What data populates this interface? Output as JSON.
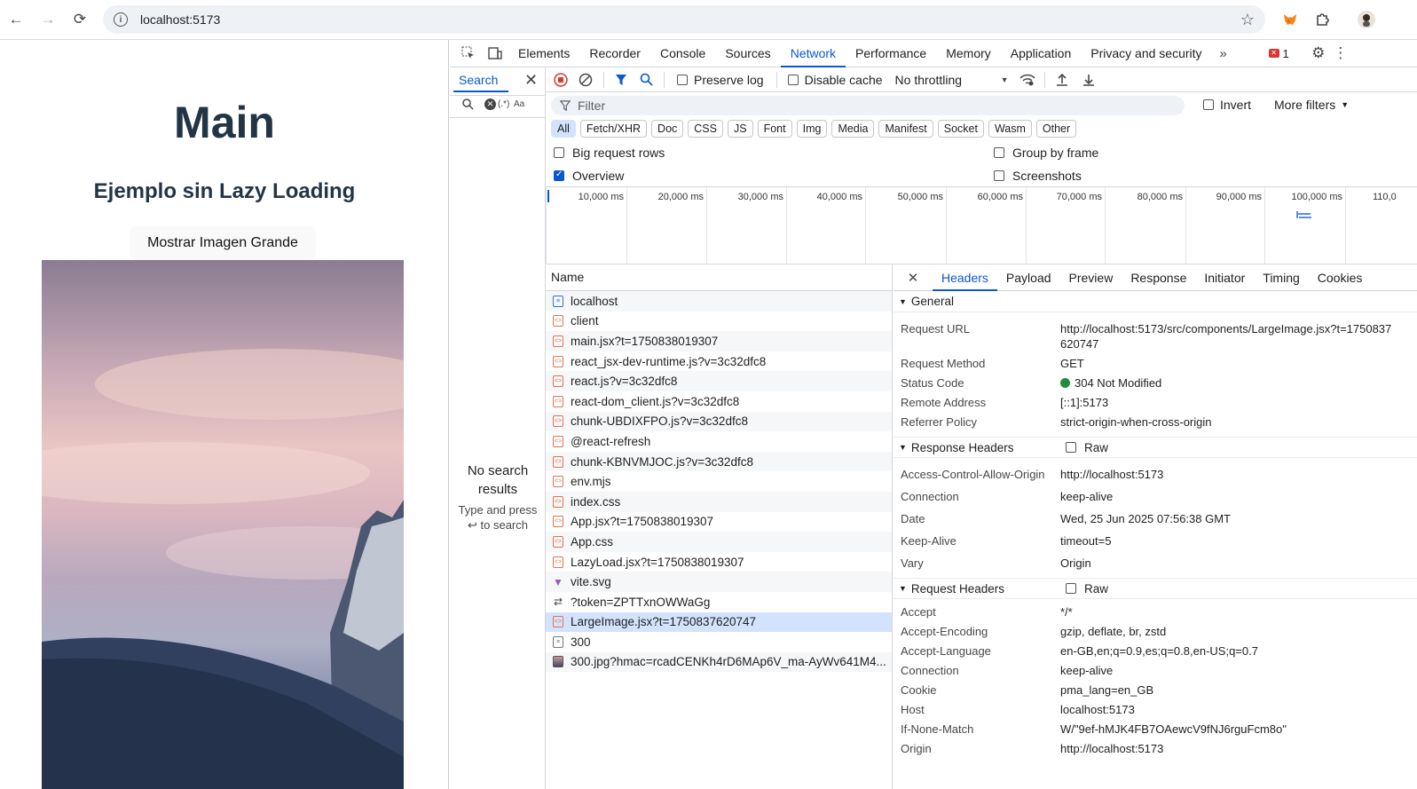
{
  "browser": {
    "url": "localhost:5173"
  },
  "page": {
    "title": "Main",
    "subtitle": "Ejemplo sin Lazy Loading",
    "button_label": "Mostrar Imagen Grande"
  },
  "devtools": {
    "tabs": [
      "Elements",
      "Recorder",
      "Console",
      "Sources",
      "Network",
      "Performance",
      "Memory",
      "Application",
      "Privacy and security"
    ],
    "active_tab": "Network",
    "error_count": "1",
    "search": {
      "title": "Search",
      "case_label": "Aa",
      "regex_label": "(.*)",
      "no_results": "No search results",
      "hint": "Type and press ↩ to search"
    },
    "toolbar": {
      "preserve_log": "Preserve log",
      "disable_cache": "Disable cache",
      "throttling": "No throttling"
    },
    "filter": {
      "placeholder": "Filter",
      "invert": "Invert",
      "more_filters": "More filters"
    },
    "types": [
      "All",
      "Fetch/XHR",
      "Doc",
      "CSS",
      "JS",
      "Font",
      "Img",
      "Media",
      "Manifest",
      "Socket",
      "Wasm",
      "Other"
    ],
    "options": {
      "big_rows": "Big request rows",
      "group_by_frame": "Group by frame",
      "overview": "Overview",
      "screenshots": "Screenshots"
    },
    "timeline_ticks": [
      "10,000 ms",
      "20,000 ms",
      "30,000 ms",
      "40,000 ms",
      "50,000 ms",
      "60,000 ms",
      "70,000 ms",
      "80,000 ms",
      "90,000 ms",
      "100,000 ms",
      "110,0"
    ],
    "requests_header": "Name",
    "requests": [
      {
        "name": "localhost",
        "kind": "doc"
      },
      {
        "name": "client",
        "kind": "js"
      },
      {
        "name": "main.jsx?t=1750838019307",
        "kind": "js"
      },
      {
        "name": "react_jsx-dev-runtime.js?v=3c32dfc8",
        "kind": "js"
      },
      {
        "name": "react.js?v=3c32dfc8",
        "kind": "js"
      },
      {
        "name": "react-dom_client.js?v=3c32dfc8",
        "kind": "js"
      },
      {
        "name": "chunk-UBDIXFPO.js?v=3c32dfc8",
        "kind": "js"
      },
      {
        "name": "@react-refresh",
        "kind": "js"
      },
      {
        "name": "chunk-KBNVMJOC.js?v=3c32dfc8",
        "kind": "js"
      },
      {
        "name": "env.mjs",
        "kind": "js"
      },
      {
        "name": "index.css",
        "kind": "js"
      },
      {
        "name": "App.jsx?t=1750838019307",
        "kind": "js"
      },
      {
        "name": "App.css",
        "kind": "js"
      },
      {
        "name": "LazyLoad.jsx?t=1750838019307",
        "kind": "js"
      },
      {
        "name": "vite.svg",
        "kind": "svg"
      },
      {
        "name": "?token=ZPTTxnOWWaGg",
        "kind": "ws"
      },
      {
        "name": "LargeImage.jsx?t=1750837620747",
        "kind": "js"
      },
      {
        "name": "300",
        "kind": "img"
      },
      {
        "name": "300.jpg?hmac=rcadCENKh4rD6MAp6V_ma-AyWv641M4...",
        "kind": "jpg"
      }
    ],
    "details": {
      "tabs": [
        "Headers",
        "Payload",
        "Preview",
        "Response",
        "Initiator",
        "Timing",
        "Cookies"
      ],
      "general_title": "General",
      "general": [
        {
          "k": "Request URL",
          "v": "http://localhost:5173/src/components/LargeImage.jsx?t=1750837620747"
        },
        {
          "k": "Request Method",
          "v": "GET"
        },
        {
          "k": "Status Code",
          "v": "304 Not Modified"
        },
        {
          "k": "Remote Address",
          "v": "[::1]:5173"
        },
        {
          "k": "Referrer Policy",
          "v": "strict-origin-when-cross-origin"
        }
      ],
      "response_title": "Response Headers",
      "raw_label": "Raw",
      "response": [
        {
          "k": "Access-Control-Allow-Origin",
          "v": "http://localhost:5173"
        },
        {
          "k": "Connection",
          "v": "keep-alive"
        },
        {
          "k": "Date",
          "v": "Wed, 25 Jun 2025 07:56:38 GMT"
        },
        {
          "k": "Keep-Alive",
          "v": "timeout=5"
        },
        {
          "k": "Vary",
          "v": "Origin"
        }
      ],
      "request_title": "Request Headers",
      "request": [
        {
          "k": "Accept",
          "v": "*/*"
        },
        {
          "k": "Accept-Encoding",
          "v": "gzip, deflate, br, zstd"
        },
        {
          "k": "Accept-Language",
          "v": "en-GB,en;q=0.9,es;q=0.8,en-US;q=0.7"
        },
        {
          "k": "Connection",
          "v": "keep-alive"
        },
        {
          "k": "Cookie",
          "v": "pma_lang=en_GB"
        },
        {
          "k": "Host",
          "v": "localhost:5173"
        },
        {
          "k": "If-None-Match",
          "v": "W/\"9ef-hMJK4FB7OAewcV9fNJ6rguFcm8o\""
        },
        {
          "k": "Origin",
          "v": "http://localhost:5173"
        }
      ]
    }
  }
}
